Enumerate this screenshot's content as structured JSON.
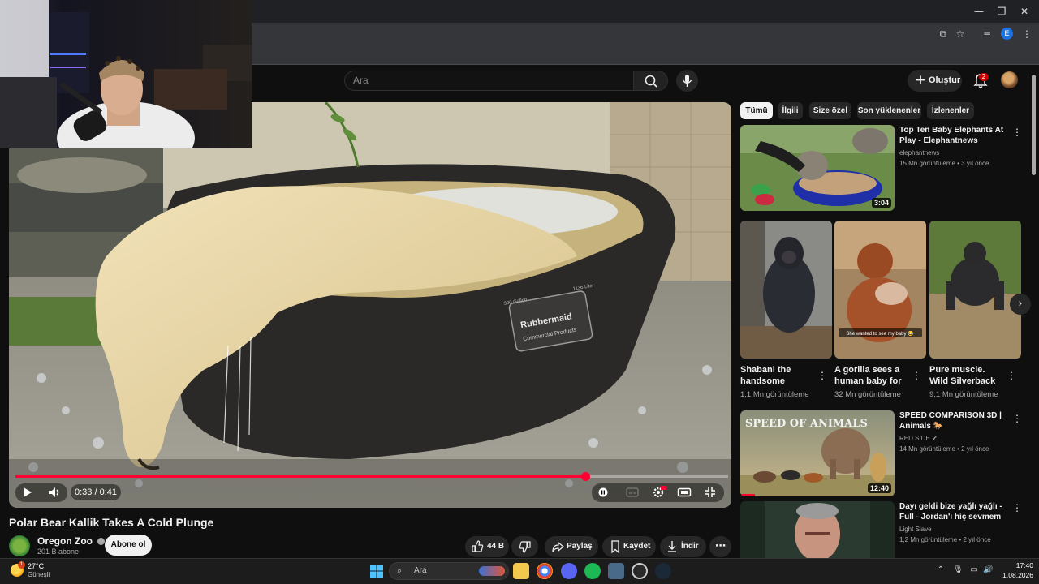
{
  "window": {
    "minimize_glyph": "—",
    "maximize_glyph": "❐",
    "close_glyph": "✕"
  },
  "browser": {
    "profile_initial": "E"
  },
  "header": {
    "search_placeholder": "Ara",
    "create_label": "Oluştur",
    "notification_count": "2"
  },
  "player": {
    "time": "0:33 / 0:41",
    "progress": 0.8,
    "tub_brand": "Rubbermaid",
    "tub_subtext": "Commercial Products",
    "tub_capacity_left": "300 Gallon",
    "tub_capacity_right": "1136 Liter"
  },
  "video": {
    "title": "Polar Bear Kallik Takes A Cold Plunge",
    "channel": "Oregon Zoo",
    "subscribers": "201 B abone",
    "subscribe_label": "Abone ol",
    "likes": "44 B",
    "share_label": "Paylaş",
    "save_label": "Kaydet",
    "download_label": "İndir"
  },
  "chips": [
    {
      "label": "Tümü",
      "active": true
    },
    {
      "label": "İlgili",
      "active": false
    },
    {
      "label": "Size özel",
      "active": false
    },
    {
      "label": "Son yüklenenler",
      "active": false
    },
    {
      "label": "İzlenenler",
      "active": false
    }
  ],
  "recommendations": [
    {
      "title": "Top Ten Baby Elephants At Play - Elephantnews",
      "channel": "elephantnews",
      "meta": "15 Mn görüntüleme • 3 yıl önce",
      "duration": "3:04"
    },
    {
      "title": "SPEED COMPARISON 3D | Animals 🐎",
      "channel": "RED SIDE ✔",
      "meta": "14 Mn görüntüleme • 2 yıl önce",
      "duration": "12:40",
      "thumb_text": "SPEED OF ANIMALS"
    },
    {
      "title": "Dayı geldi bize yağlı yağlı - Full - Jordan'ı hiç sevmem",
      "channel": "Light Slave",
      "meta": "1,2 Mn görüntüleme • 2 yıl önce"
    }
  ],
  "shorts": [
    {
      "title": "Shabani the handsome gorill...",
      "views": "1,1 Mn görüntüleme"
    },
    {
      "title": "A gorilla sees a human baby for ...",
      "views": "32 Mn görüntüleme",
      "caption": "She wanted to see my baby 😂"
    },
    {
      "title": "Pure muscle.  Wild Silverback gorilla...",
      "views": "9,1 Mn görüntüleme"
    }
  ],
  "taskbar": {
    "weather_temp": "27°C",
    "weather_desc": "Güneşli",
    "weather_badge": "1",
    "search_placeholder": "Ara",
    "time": "17:40",
    "date": "1.08.2026"
  },
  "colors": {
    "accent_red": "#ff0033",
    "background": "#0f0f0f",
    "chip_bg": "#272727"
  }
}
